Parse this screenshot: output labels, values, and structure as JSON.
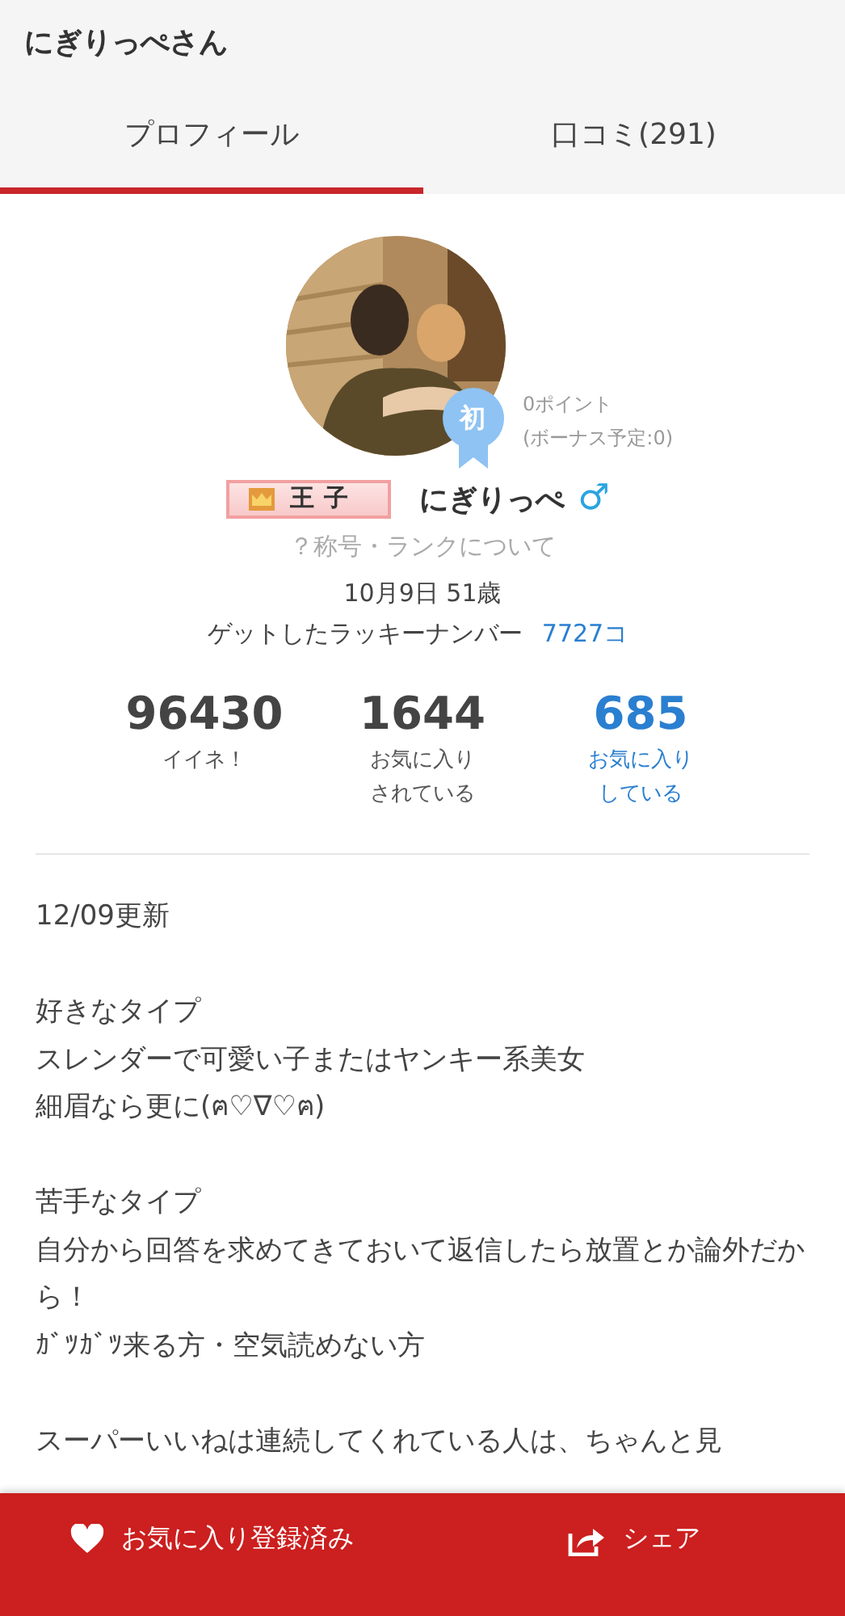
{
  "header": {
    "title": "にぎりっぺさん"
  },
  "tabs": [
    {
      "label": "プロフィール",
      "selected": true
    },
    {
      "label": "口コミ(291)",
      "selected": false
    }
  ],
  "profile": {
    "first_badge": "初",
    "points": "0ポイント",
    "bonus": "(ボーナス予定:0)",
    "rank": "王子",
    "name": "にぎりっぺ",
    "gender": "♂",
    "rank_link": "？称号・ランクについて",
    "birthday": "10月9日 51歳",
    "lucky_label": "ゲットしたラッキーナンバー",
    "lucky_value": "7727コ"
  },
  "stats": [
    {
      "value": "96430",
      "lines": [
        "イイネ！"
      ],
      "kind": "plain"
    },
    {
      "value": "1644",
      "lines": [
        "お気に入り",
        "されている"
      ],
      "kind": "plain"
    },
    {
      "value": "685",
      "lines": [
        "お気に入り",
        "している"
      ],
      "kind": "link"
    }
  ],
  "bio": {
    "updated": "12/09更新",
    "paragraphs": [
      [
        "好きなタイプ",
        "スレンダーで可愛い子またはヤンキー系美女",
        "細眉なら更に(ฅ♡∇♡ฅ)"
      ],
      [
        "苦手なタイプ",
        "自分から回答を求めてきておいて返信したら放置とか論外だから！",
        "ｶﾞﾂｶﾞﾂ来る方・空気読めない方"
      ],
      [
        "スーパーいいねは連続してくれている人は、ちゃんと見"
      ]
    ]
  },
  "footer": [
    {
      "kind": "favorite",
      "label": "お気に入り登録済み"
    },
    {
      "kind": "share",
      "label": "シェア"
    }
  ]
}
